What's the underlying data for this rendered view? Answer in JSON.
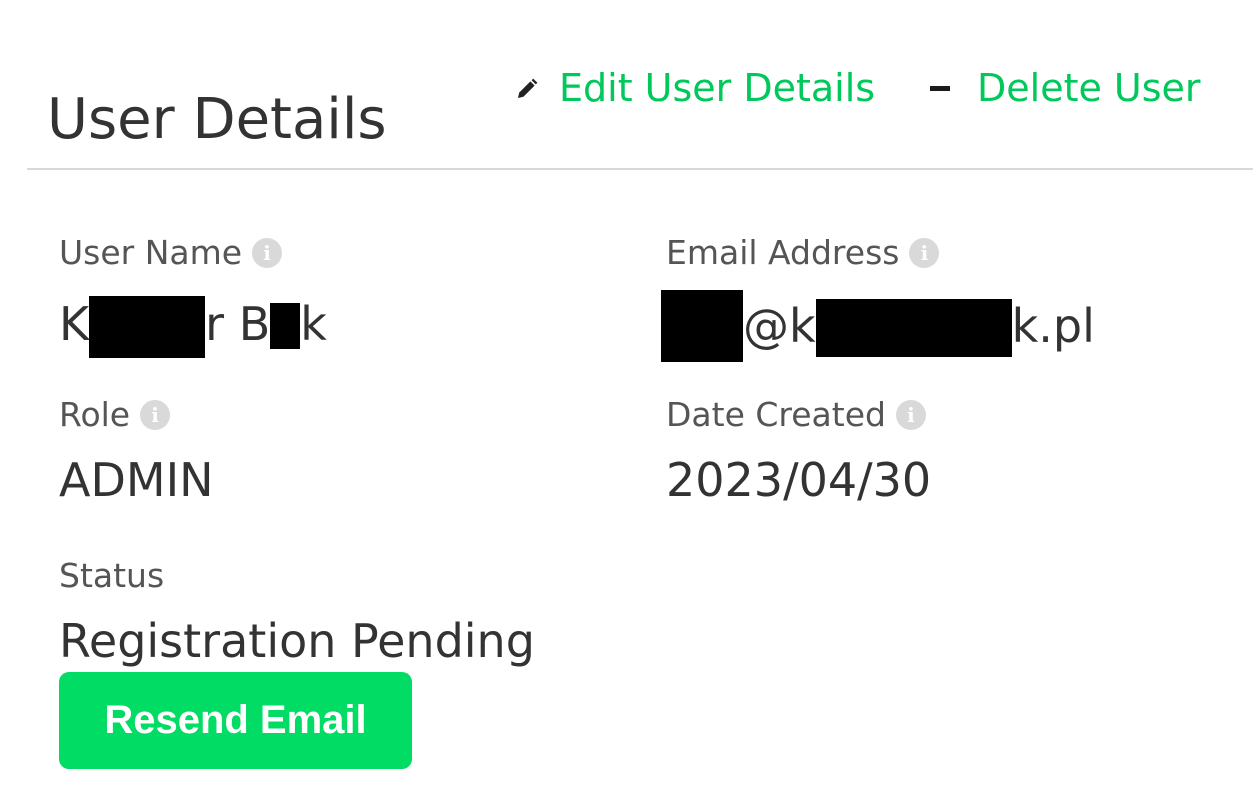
{
  "header": {
    "title": "User Details",
    "edit_label": "Edit User Details",
    "delete_label": "Delete User",
    "edit_icon": "pencil-icon",
    "delete_icon": "minus-icon"
  },
  "fields": {
    "username": {
      "label": "User Name",
      "value_parts": [
        "K",
        "r B",
        "k"
      ]
    },
    "email": {
      "label": "Email Address",
      "value_parts": [
        "@k",
        "k.pl"
      ]
    },
    "role": {
      "label": "Role",
      "value": "ADMIN"
    },
    "date_created": {
      "label": "Date Created",
      "value": "2023/04/30"
    },
    "status": {
      "label": "Status",
      "value": "Registration Pending"
    }
  },
  "actions": {
    "resend_label": "Resend Email"
  },
  "icons": {
    "info_glyph": "i"
  },
  "colors": {
    "accent": "#00c85a",
    "button": "#00dc64",
    "text": "#333333",
    "label": "#555555",
    "divider": "#d8d8d8",
    "info_icon": "#d9d9d9"
  }
}
